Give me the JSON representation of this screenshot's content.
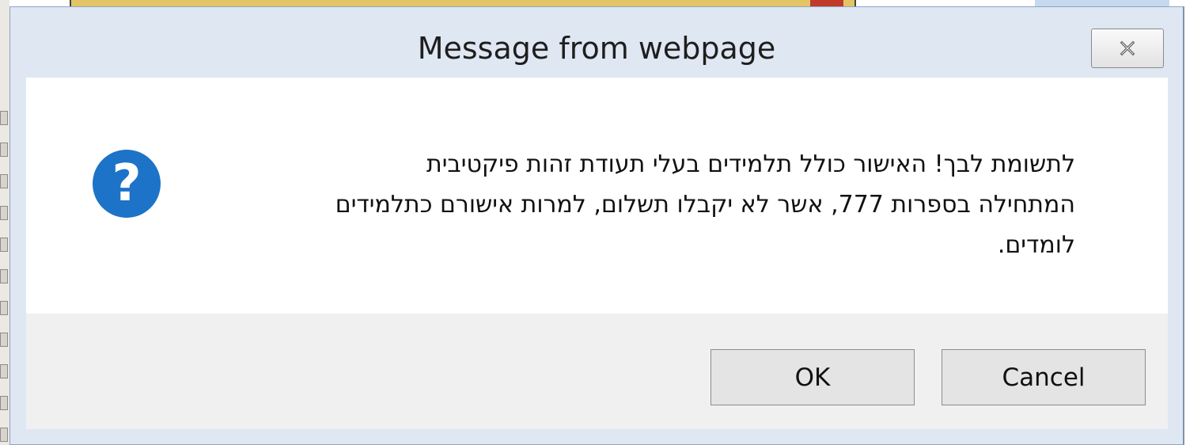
{
  "dialog": {
    "title": "Message from webpage",
    "close_icon": "close-x-icon",
    "message_icon": "question-icon",
    "message_icon_glyph": "?",
    "message_lines": [
      "לתשומת לבך! האישור כולל תלמידים בעלי תעודת זהות פיקטיבית",
      "המתחילה בספרות 777, אשר לא יקבלו תשלום, למרות אישורם כתלמידים",
      "לומדים."
    ],
    "buttons": {
      "ok_label": "OK",
      "cancel_label": "Cancel"
    }
  },
  "colors": {
    "dialog_frame": "#dfe7f2",
    "content_bg": "#ffffff",
    "footer_bg": "#f0f0f0",
    "icon_blue": "#1d73c7"
  }
}
